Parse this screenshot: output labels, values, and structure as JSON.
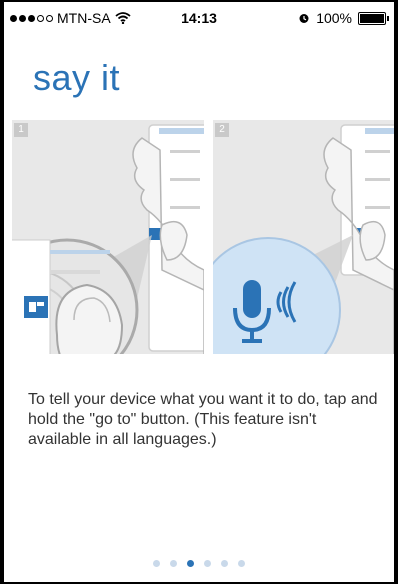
{
  "status_bar": {
    "carrier": "MTN-SA",
    "time": "14:13",
    "battery": "100%",
    "signal_bars_filled": 3,
    "signal_bars_total": 5
  },
  "page": {
    "title": "say it",
    "panel1_number": "1",
    "panel2_number": "2",
    "caption": "To tell your device what you want it to do, tap and hold the \"go to\" button. (This feature isn't available in all languages.)"
  },
  "pager": {
    "count": 6,
    "active_index": 2
  },
  "colors": {
    "accent": "#2b73b6",
    "panel_bg": "#e8e8e8",
    "mic_bubble": "#cfe3f5"
  },
  "icons": [
    "wifi-icon",
    "alarm-icon",
    "battery-icon",
    "go-to-button-icon",
    "microphone-icon",
    "sound-waves-icon"
  ]
}
